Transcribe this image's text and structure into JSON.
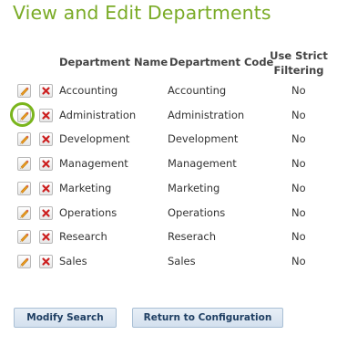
{
  "page": {
    "title": "View and Edit Departments"
  },
  "table": {
    "headers": {
      "name": "Department Name",
      "code": "Department Code",
      "strict_line1": "Use Strict",
      "strict_line2": "Filtering"
    },
    "rows": [
      {
        "name": "Accounting",
        "code": "Accounting",
        "strict": "No"
      },
      {
        "name": "Administration",
        "code": "Administration",
        "strict": "No"
      },
      {
        "name": "Development",
        "code": "Development",
        "strict": "No"
      },
      {
        "name": "Management",
        "code": "Management",
        "strict": "No"
      },
      {
        "name": "Marketing",
        "code": "Marketing",
        "strict": "No"
      },
      {
        "name": "Operations",
        "code": "Operations",
        "strict": "No"
      },
      {
        "name": "Research",
        "code": "Reserach",
        "strict": "No"
      },
      {
        "name": "Sales",
        "code": "Sales",
        "strict": "No"
      }
    ],
    "highlighted_row_index": 1
  },
  "actions": {
    "modify_search": "Modify Search",
    "return_to_configuration": "Return to Configuration"
  },
  "icons": {
    "edit": "pencil-icon",
    "delete": "close-icon"
  },
  "colors": {
    "title": "#7aab26",
    "highlight": "#7ab51d",
    "delete": "#cc1f1f",
    "button_text": "#1f3f63"
  }
}
